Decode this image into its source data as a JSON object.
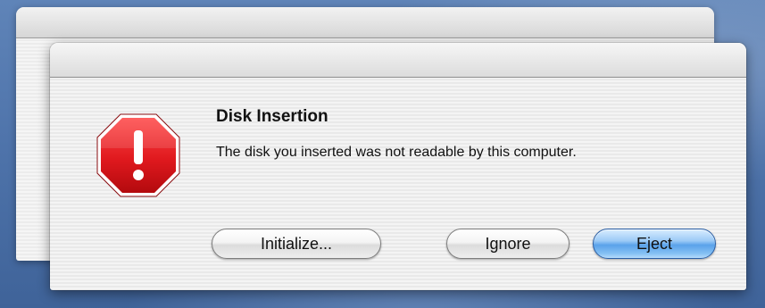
{
  "dialog": {
    "title": "Disk Insertion",
    "message": "The disk you inserted was not readable by this computer.",
    "icon": "stop-alert-icon"
  },
  "buttons": {
    "initialize_label": "Initialize...",
    "ignore_label": "Ignore",
    "eject_label": "Eject"
  },
  "colors": {
    "stop_icon_red": "#e0191e",
    "default_button_blue": "#5aa2ea"
  }
}
